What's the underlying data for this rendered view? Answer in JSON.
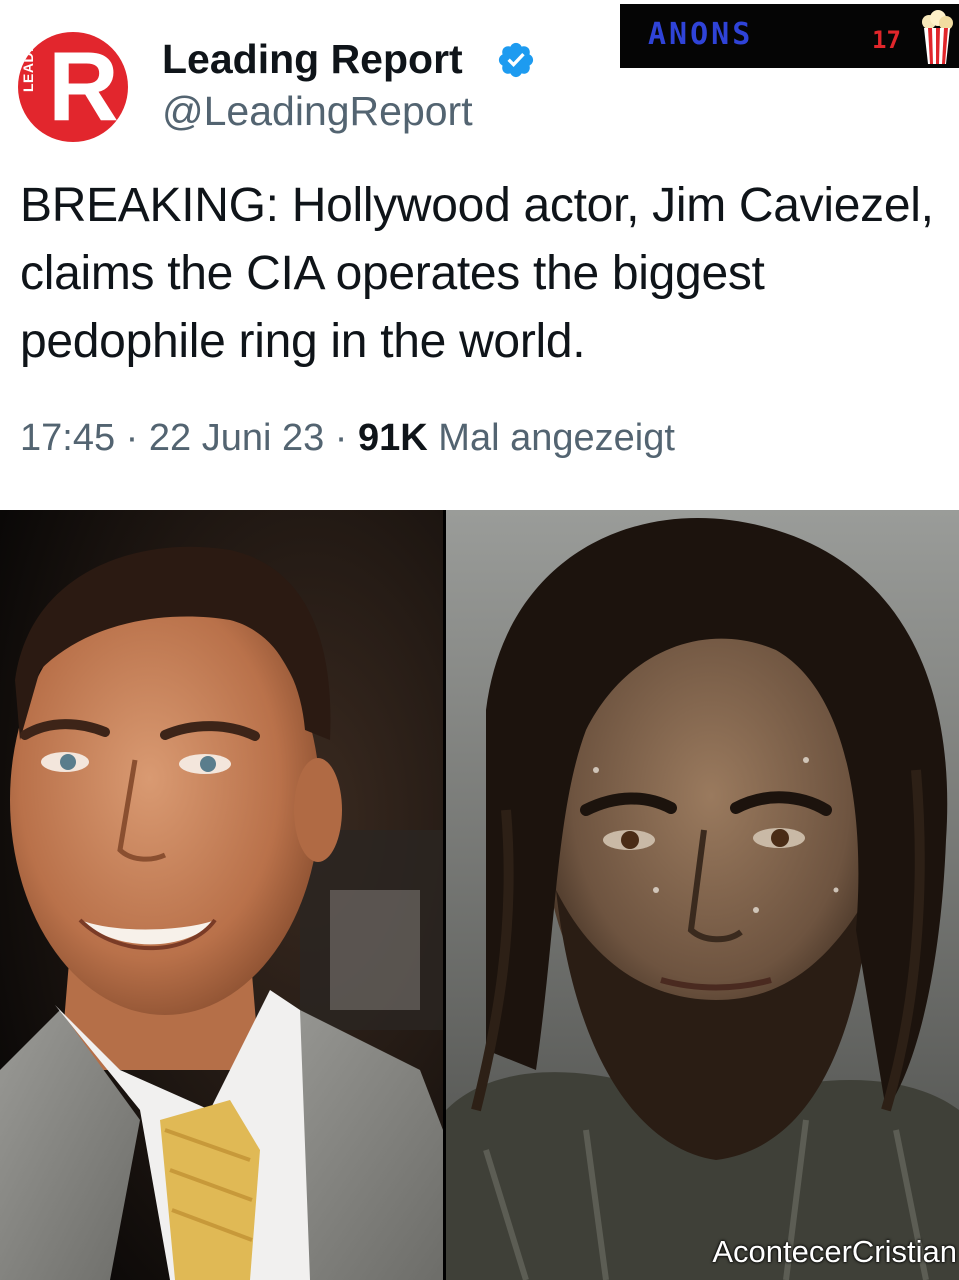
{
  "author": {
    "avatar_label": "LEADING",
    "avatar_letter": "R",
    "name": "Leading Report",
    "handle": "@LeadingReport",
    "verified": true
  },
  "watermark": {
    "text": "ANONS",
    "number": "17",
    "icon": "popcorn-icon"
  },
  "tweet": {
    "text": "BREAKING: Hollywood actor, Jim Caviezel, claims the CIA operates the biggest pedophile ring in the world.",
    "time": "17:45",
    "sep1": " · ",
    "date": "22 Juni 23",
    "sep2": " · ",
    "views_count": "91K",
    "views_label": " Mal angezeigt"
  },
  "media": {
    "credit": "AcontecerCristian"
  },
  "colors": {
    "accent_blue": "#1d9bf0",
    "avatar_red": "#e2262d",
    "text_primary": "#0f1419",
    "text_secondary": "#536471"
  }
}
